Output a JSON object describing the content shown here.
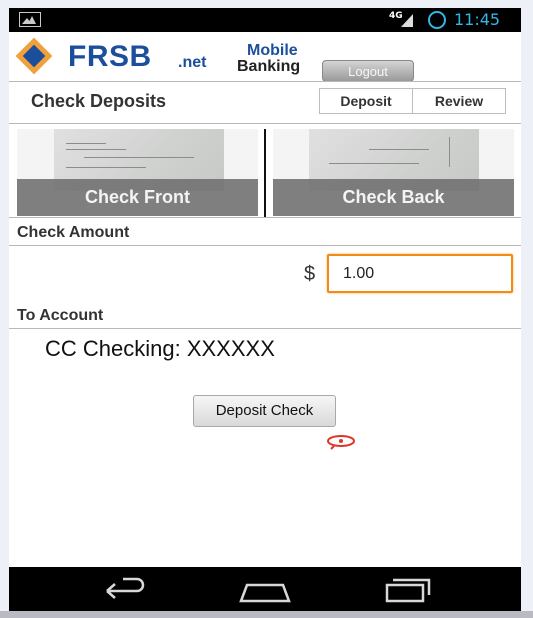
{
  "status_bar": {
    "network": "4G",
    "time": "11:45",
    "icons": [
      "image-icon",
      "signal-icon",
      "sync-icon"
    ]
  },
  "header": {
    "logo_text": "FRSB",
    "logo_suffix": ".net",
    "brand_line1": "Mobile",
    "brand_line2": "Banking",
    "logout_label": "Logout"
  },
  "page": {
    "title": "Check Deposits",
    "tabs": [
      {
        "label": "Deposit"
      },
      {
        "label": "Review"
      }
    ]
  },
  "images": {
    "front_label": "Check Front",
    "back_label": "Check Back"
  },
  "check_amount": {
    "section_label": "Check Amount",
    "currency_symbol": "$",
    "value": "1.00"
  },
  "to_account": {
    "section_label": "To Account",
    "selected_account": "CC Checking: XXXXXX"
  },
  "actions": {
    "deposit_label": "Deposit Check"
  },
  "nav_bar": {
    "icons": [
      "back-icon",
      "home-icon",
      "recent-apps-icon"
    ]
  },
  "colors": {
    "brand_blue": "#1c4f9b",
    "brand_orange": "#f2a03a",
    "input_focus": "#f08c16",
    "status_accent": "#33b5e5"
  }
}
